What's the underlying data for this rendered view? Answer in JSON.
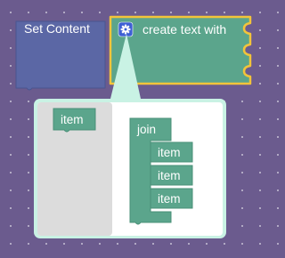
{
  "workspace": {
    "background": "#6b5b8e",
    "blocks": {
      "set_content": {
        "label": "Set Content",
        "color": "#5b67a5"
      },
      "create_text_with": {
        "label": "create text with",
        "color": "#5ba58c",
        "selected_outline": "#f2c43a",
        "mutator_icon": "gear-icon"
      }
    },
    "mutator": {
      "flyout_item": {
        "label": "item"
      },
      "join": {
        "label": "join",
        "items": [
          "item",
          "item",
          "item"
        ]
      }
    }
  }
}
